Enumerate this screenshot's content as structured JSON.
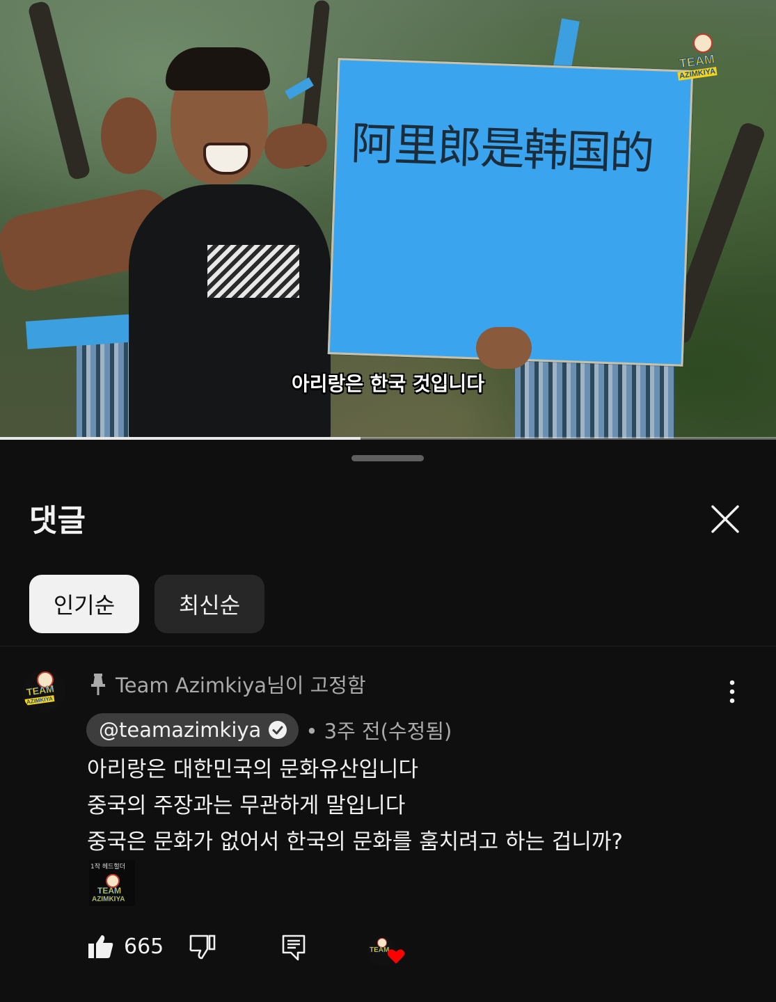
{
  "video": {
    "sign_text": "阿里郎是韩国的",
    "subtitle": "아리랑은 한국 것입니다",
    "watermark_line1": "TEAM",
    "watermark_line2": "AZIMKIYA",
    "progress_fraction": 0.465
  },
  "comments_panel": {
    "title": "댓글",
    "sort_chips": [
      {
        "label": "인기순",
        "selected": true
      },
      {
        "label": "최신순",
        "selected": false
      }
    ]
  },
  "comment": {
    "pinned_label": "Team Azimkiya님이 고정함",
    "author": "@teamazimkiya",
    "verified": true,
    "meta": "• 3주 전(수정됨)",
    "lines": [
      "아리랑은 대한민국의 문화유산입니다",
      "중국의 주장과는 무관하게 말입니다",
      "중국은 문화가 없어서 한국의 문화를 훔치려고 하는 겁니까?"
    ],
    "sticker_caption": "1작 헤드헐더",
    "sticker_line1": "TEAM",
    "sticker_line2": "AZIMKIYA",
    "avatar_line1": "TEAM",
    "avatar_line2": "AZIMKIYA",
    "likes": "665",
    "icons": [
      "pin-icon",
      "verified-icon",
      "more-vert-icon",
      "thumb-up-icon",
      "thumb-down-icon",
      "reply-icon",
      "heart-icon",
      "close-icon"
    ]
  },
  "colors": {
    "background": "#0f0f0f",
    "chip_active": "#f1f1f1",
    "chip_inactive": "#272727",
    "secondary_text": "#aaaaaa",
    "heart": "#ff0000"
  }
}
